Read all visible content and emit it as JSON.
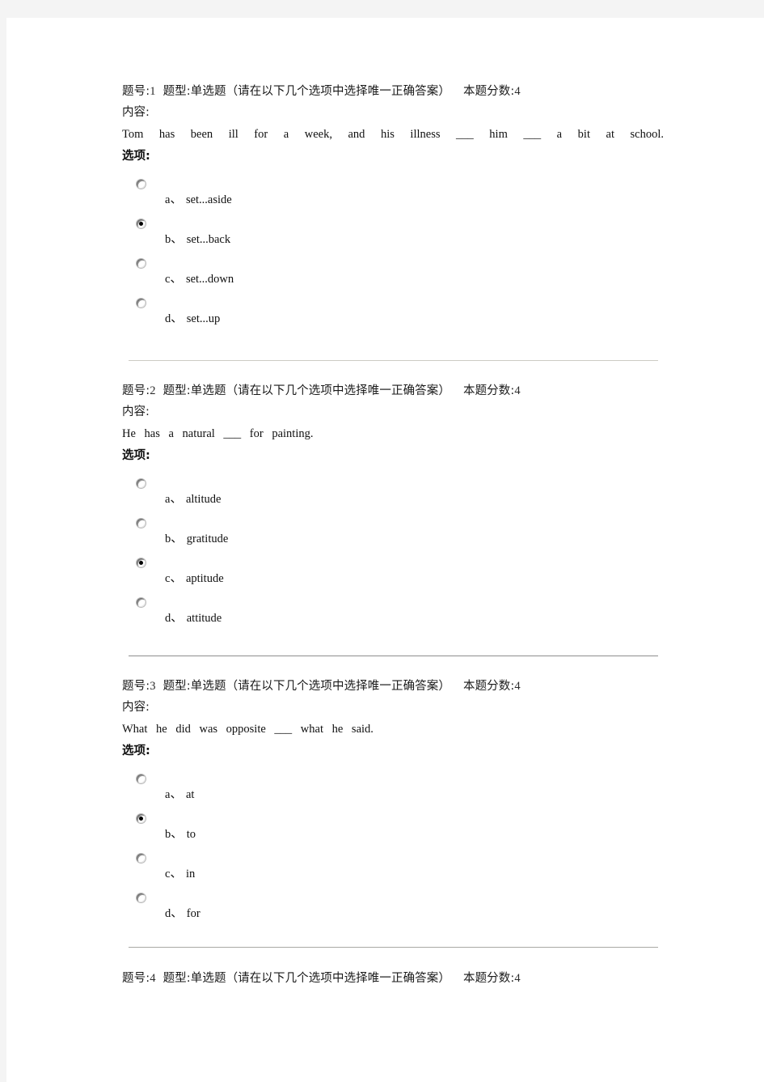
{
  "document": {
    "labels": {
      "question_number_prefix": "题号",
      "question_type_prefix": "题型",
      "question_type_value": "单选题（请在以下几个选项中选择唯一正确答案）",
      "score_prefix": "本题分数",
      "content_label": "内容:",
      "options_label": "选项:",
      "colon": ":",
      "option_separator": "、"
    },
    "questions": [
      {
        "number": "1",
        "type": "单选题（请在以下几个选项中选择唯一正确答案）",
        "score": "4",
        "content": "Tom has been ill for a week, and his illness ___ him ___ a bit at school.",
        "options": [
          {
            "letter": "a",
            "text": "set...aside",
            "selected": false
          },
          {
            "letter": "b",
            "text": "set...back",
            "selected": true
          },
          {
            "letter": "c",
            "text": "set...down",
            "selected": false
          },
          {
            "letter": "d",
            "text": "set...up",
            "selected": false
          }
        ]
      },
      {
        "number": "2",
        "type": "单选题（请在以下几个选项中选择唯一正确答案）",
        "score": "4",
        "content": "He has a natural ___ for painting.",
        "options": [
          {
            "letter": "a",
            "text": "altitude",
            "selected": false
          },
          {
            "letter": "b",
            "text": "gratitude",
            "selected": false
          },
          {
            "letter": "c",
            "text": "aptitude",
            "selected": true
          },
          {
            "letter": "d",
            "text": "attitude",
            "selected": false
          }
        ]
      },
      {
        "number": "3",
        "type": "单选题（请在以下几个选项中选择唯一正确答案）",
        "score": "4",
        "content": "What he did was opposite ___ what he said.",
        "options": [
          {
            "letter": "a",
            "text": "at",
            "selected": false
          },
          {
            "letter": "b",
            "text": "to",
            "selected": true
          },
          {
            "letter": "c",
            "text": "in",
            "selected": false
          },
          {
            "letter": "d",
            "text": "for",
            "selected": false
          }
        ]
      },
      {
        "number": "4",
        "type": "单选题（请在以下几个选项中选择唯一正确答案）",
        "score": "4",
        "content": "",
        "options": []
      }
    ]
  }
}
